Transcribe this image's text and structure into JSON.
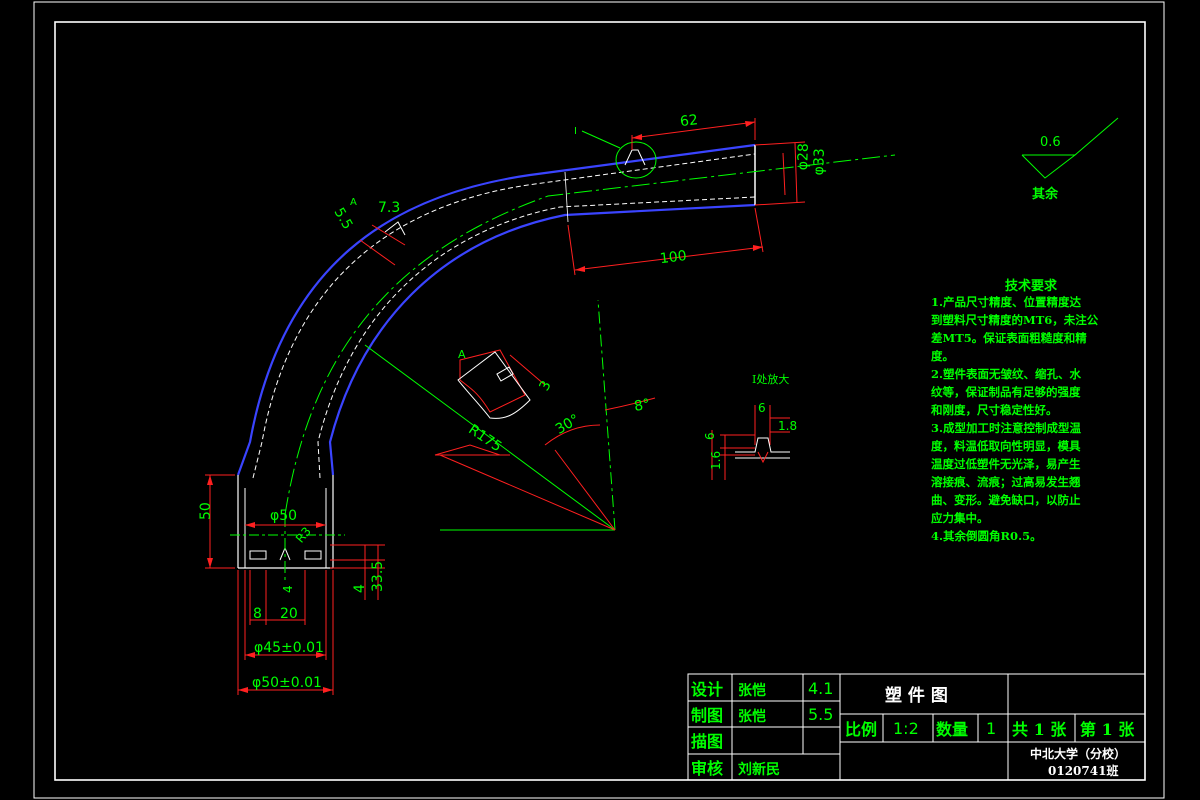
{
  "colors": {
    "background": "#000000",
    "border": "#ffffff",
    "part_outline": "#3a44ff",
    "part_inner": "#ffffff",
    "centerline": "#00ff00",
    "dimension": "#ff2020",
    "text_green": "#00ff00",
    "text_title": "#ffffff"
  },
  "dimensions": {
    "d62": "62",
    "d100": "100",
    "phi33": "φ33",
    "phi28": "φ28",
    "d55": "5.5",
    "d73": "7.3",
    "r175": "R175",
    "ang30": "30°",
    "ang8": "8°",
    "d50": "50",
    "phi50": "φ50",
    "r3": "R3",
    "d4": "4",
    "d8": "8",
    "d20": "20",
    "d335": "33.5",
    "phi45_tol": "φ45±0.01",
    "phi50_tol": "φ50±0.01",
    "section_a": "A",
    "section_3": "3",
    "detail_i": "I"
  },
  "surface_finish": {
    "value": "0.6",
    "label": "其余"
  },
  "detail_view": {
    "title": "I处放大",
    "d6_top": "6",
    "d18": "1.8",
    "d6_left": "6",
    "d16": "1.6"
  },
  "tech_requirements": {
    "title": "技术要求",
    "lines": [
      "1.产品尺寸精度、位置精度达",
      "到塑料尺寸精度的MT6，未注公",
      "差MT5。保证表面粗糙度和精",
      "度。",
      "2.塑件表面无皱纹、缩孔、水",
      "纹等，保证制品有足够的强度",
      "和刚度，尺寸稳定性好。",
      "3.成型加工时注意控制成型温",
      "度，料温低取向性明显，模具",
      "温度过低塑件无光泽，易产生",
      "溶接痕、流痕；过高易发生翘",
      "曲、变形。避免缺口，以防止",
      "应力集中。",
      "4.其余倒圆角R0.5。"
    ]
  },
  "title_block": {
    "design_label": "设计",
    "design_name": "张恺",
    "design_date": "4.1",
    "drawing_label": "制图",
    "drawing_name": "张恺",
    "drawing_date": "5.5",
    "trace_label": "描图",
    "review_label": "审核",
    "review_name": "刘新民",
    "drawing_title": "塑 件 图",
    "scale_label": "比例",
    "scale_value": "1:2",
    "qty_label": "数量",
    "qty_value": "1",
    "total_sheets": "共 1 张",
    "sheet_no": "第 1 张",
    "school": "中北大学（分校）",
    "class_code": "0120741班"
  }
}
